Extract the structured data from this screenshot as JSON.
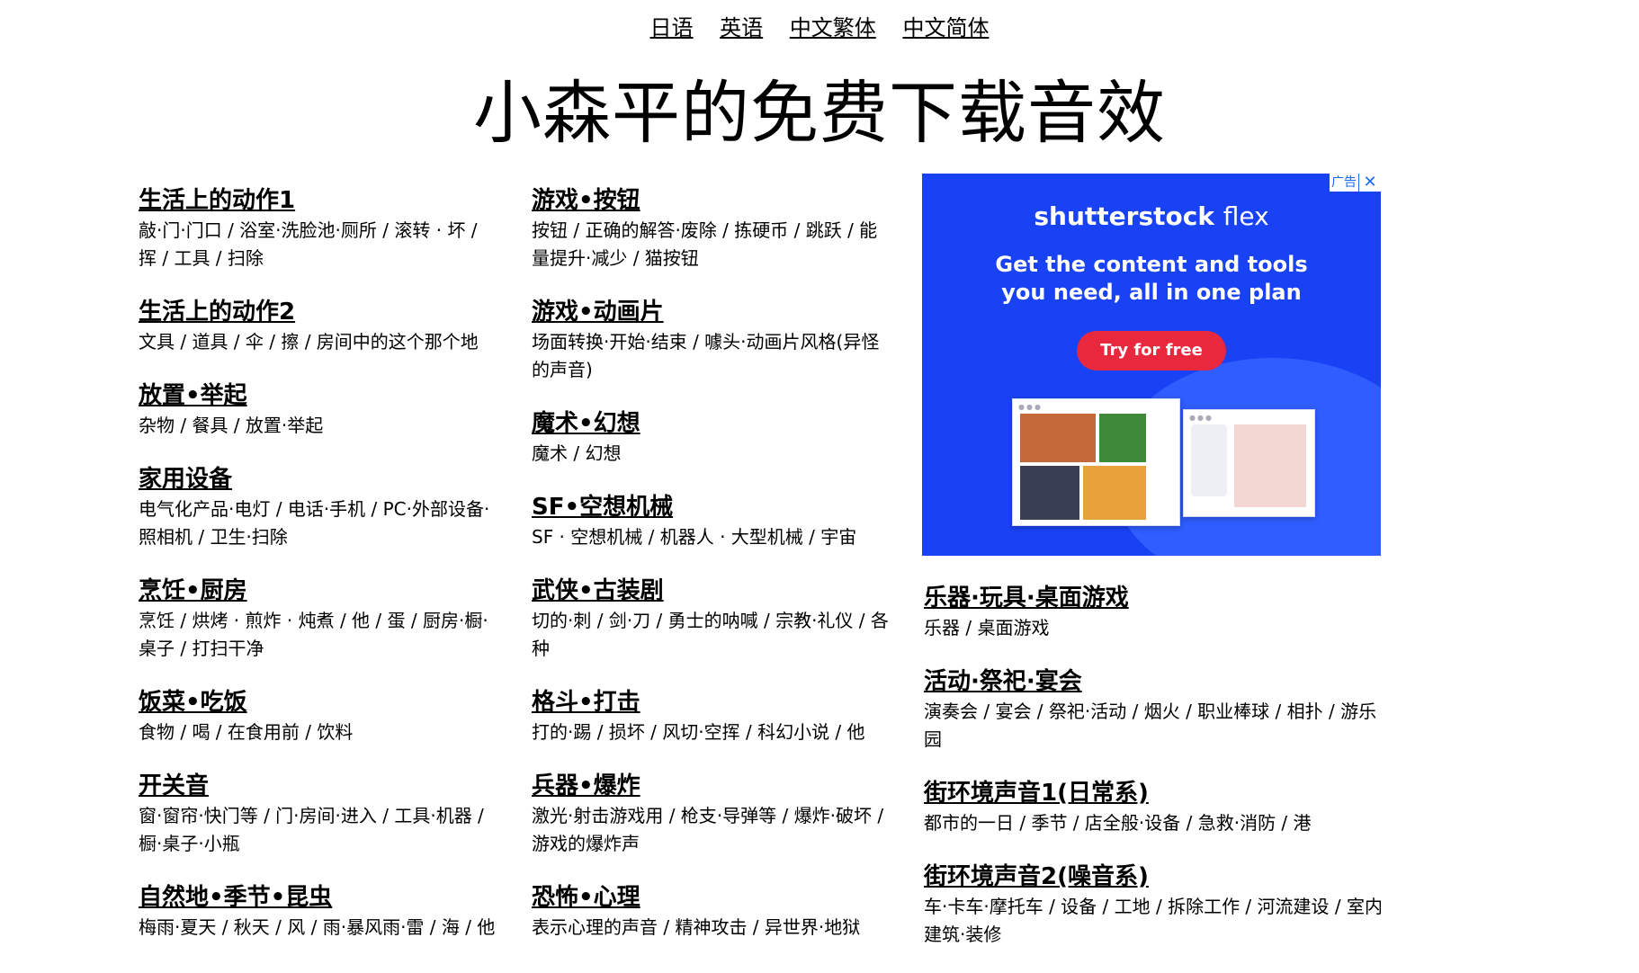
{
  "nav": {
    "languages": [
      "日语",
      "英语",
      "中文繁体",
      "中文简体"
    ]
  },
  "title": "小森平的免费下载音效",
  "columns": [
    [
      {
        "title": "生活上的动作1",
        "desc": "敲·门·门口 / 浴室·洗脸池·厕所 / 滚转 · 坏 / 挥 / 工具 / 扫除"
      },
      {
        "title": "生活上的动作2",
        "desc": "文具 / 道具 / 伞 / 擦 / 房间中的这个那个地"
      },
      {
        "title": "放置•举起",
        "desc": "杂物 / 餐具 / 放置·举起"
      },
      {
        "title": "家用设备",
        "desc": "电气化产品·电灯 / 电话·手机 / PC·外部设备·照相机 / 卫生·扫除"
      },
      {
        "title": "烹饪•厨房",
        "desc": "烹饪 / 烘烤 · 煎炸 · 炖煮 / 他 / 蛋 / 厨房·橱·桌子 / 打扫干净"
      },
      {
        "title": "饭菜•吃饭",
        "desc": "食物 / 喝 / 在食用前 / 饮料"
      },
      {
        "title": "开关音",
        "desc": "窗·窗帘·快门等 / 门·房间·进入 / 工具·机器 / 橱·桌子·小瓶"
      },
      {
        "title": "自然地•季节•昆虫",
        "desc": "梅雨·夏天 / 秋天 / 风 / 雨·暴风雨·雷 / 海 / 他"
      }
    ],
    [
      {
        "title": "游戏•按钮",
        "desc": "按钮 / 正确的解答·废除 / 拣硬币 / 跳跃 / 能量提升·减少 / 猫按钮"
      },
      {
        "title": "游戏•动画片",
        "desc": "场面转换·开始·结束 / 噱头·动画片风格(异怪的声音)"
      },
      {
        "title": "魔术•幻想",
        "desc": "魔术 / 幻想"
      },
      {
        "title": "SF•空想机械",
        "desc": "SF · 空想机械 / 机器人 · 大型机械 / 宇宙"
      },
      {
        "title": "武侠•古装剧",
        "desc": "切的·刺 / 剑·刀 / 勇士的呐喊 / 宗教·礼仪 / 各种"
      },
      {
        "title": "格斗•打击",
        "desc": "打的·踢 / 损坏 / 风切·空挥 / 科幻小说 / 他"
      },
      {
        "title": "兵器•爆炸",
        "desc": "激光·射击游戏用 / 枪支·导弹等 / 爆炸·破坏 / 游戏的爆炸声"
      },
      {
        "title": "恐怖•心理",
        "desc": "表示心理的声音 / 精神攻击 / 异世界·地狱"
      }
    ],
    [
      {
        "title": "乐器·玩具·桌面游戏",
        "desc": "乐器 / 桌面游戏"
      },
      {
        "title": "活动·祭祀·宴会",
        "desc": "演奏会 / 宴会 / 祭祀·活动 / 烟火 / 职业棒球 / 相扑 / 游乐园"
      },
      {
        "title": "街环境声音1(日常系)",
        "desc": "都市的一日 / 季节 / 店全般·设备 / 急救·消防 / 港"
      },
      {
        "title": "街环境声音2(噪音系)",
        "desc": "车·卡车·摩托车 / 设备 / 工地 / 拆除工作 / 河流建设 / 室内建筑·装修"
      }
    ]
  ],
  "ad": {
    "badge": "广告",
    "close": "✕",
    "logo_brand": "shutterstock",
    "logo_suffix": "flex",
    "headline_line1": "Get the content and tools",
    "headline_line2": "you need, all in one plan",
    "cta": "Try for free",
    "bg_color": "#1a42f5",
    "cta_color": "#e8283c"
  }
}
